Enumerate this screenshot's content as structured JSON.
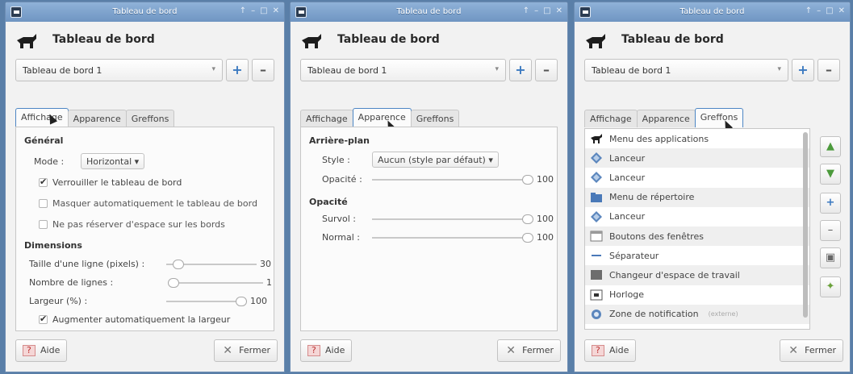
{
  "windows": [
    {
      "title": "Tableau de bord",
      "header_title": "Tableau de bord",
      "combo_value": "Tableau de bord 1",
      "tabs": [
        "Affichage",
        "Apparence",
        "Greffons"
      ],
      "active_tab": 0,
      "general": {
        "heading": "Général",
        "mode_label": "Mode :",
        "mode_value": "Horizontal",
        "lock": "Verrouiller le tableau de bord",
        "autohide": "Masquer automatiquement le tableau de bord",
        "no_reserve": "Ne pas réserver d'espace sur les bords"
      },
      "dimensions": {
        "heading": "Dimensions",
        "row_size_label": "Taille d'une ligne (pixels) :",
        "row_size_value": "30",
        "rows_label": "Nombre de lignes :",
        "rows_value": "1",
        "width_label": "Largeur (%) :",
        "width_value": "100",
        "auto_width": "Augmenter automatiquement la largeur"
      },
      "help_label": "Aide",
      "close_label": "Fermer"
    },
    {
      "title": "Tableau de bord",
      "header_title": "Tableau de bord",
      "combo_value": "Tableau de bord 1",
      "tabs": [
        "Affichage",
        "Apparence",
        "Greffons"
      ],
      "active_tab": 1,
      "background": {
        "heading": "Arrière-plan",
        "style_label": "Style :",
        "style_value": "Aucun (style par défaut)",
        "opacity_label": "Opacité :",
        "opacity_value": "100"
      },
      "opacity": {
        "heading": "Opacité",
        "hover_label": "Survol :",
        "hover_value": "100",
        "normal_label": "Normal :",
        "normal_value": "100"
      },
      "help_label": "Aide",
      "close_label": "Fermer"
    },
    {
      "title": "Tableau de bord",
      "header_title": "Tableau de bord",
      "combo_value": "Tableau de bord 1",
      "tabs": [
        "Affichage",
        "Apparence",
        "Greffons"
      ],
      "active_tab": 2,
      "plugins": [
        {
          "label": "Menu des applications",
          "icon": "app-menu-icon"
        },
        {
          "label": "Lanceur",
          "icon": "launcher-icon"
        },
        {
          "label": "Lanceur",
          "icon": "launcher-icon"
        },
        {
          "label": "Menu de répertoire",
          "icon": "folder-menu-icon"
        },
        {
          "label": "Lanceur",
          "icon": "launcher-icon"
        },
        {
          "label": "Boutons des fenêtres",
          "icon": "window-buttons-icon"
        },
        {
          "label": "Séparateur",
          "icon": "separator-icon"
        },
        {
          "label": "Changeur d'espace de travail",
          "icon": "workspace-switcher-icon"
        },
        {
          "label": "Horloge",
          "icon": "clock-icon"
        },
        {
          "label": "Zone de notification",
          "icon": "notification-area-icon",
          "extra": "(externe)"
        }
      ],
      "help_label": "Aide",
      "close_label": "Fermer"
    }
  ],
  "window_controls": [
    "↑",
    "–",
    "□",
    "✕"
  ]
}
